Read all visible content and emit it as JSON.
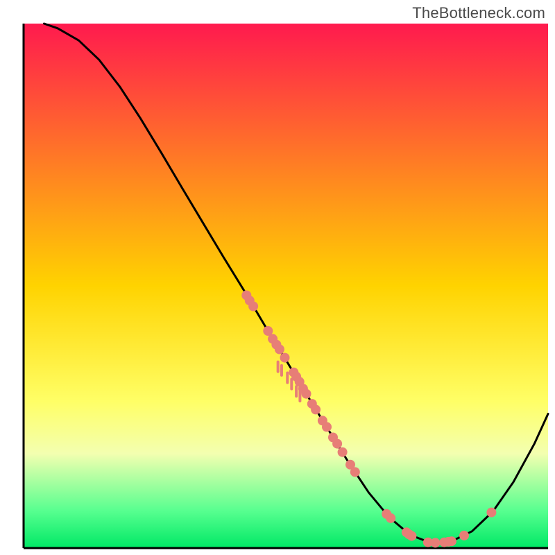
{
  "watermark": "TheBottleneck.com",
  "chart_data": {
    "type": "line",
    "title": "",
    "xlabel": "",
    "ylabel": "",
    "xlim": [
      0,
      100
    ],
    "ylim": [
      0,
      100
    ],
    "background_gradient": {
      "stops": [
        {
          "offset": 0.0,
          "color": "#ff1a4e"
        },
        {
          "offset": 0.5,
          "color": "#ffd300"
        },
        {
          "offset": 0.72,
          "color": "#ffff66"
        },
        {
          "offset": 0.82,
          "color": "#f3ffb0"
        },
        {
          "offset": 0.93,
          "color": "#56ff8f"
        },
        {
          "offset": 1.0,
          "color": "#00e865"
        }
      ]
    },
    "series": [
      {
        "name": "curve",
        "type": "line",
        "color": "#000000",
        "points": [
          {
            "x": 3.9,
            "y": 100.0
          },
          {
            "x": 6.5,
            "y": 99.1
          },
          {
            "x": 10.5,
            "y": 96.8
          },
          {
            "x": 14.4,
            "y": 93.1
          },
          {
            "x": 18.4,
            "y": 87.9
          },
          {
            "x": 22.3,
            "y": 81.9
          },
          {
            "x": 26.3,
            "y": 75.3
          },
          {
            "x": 30.2,
            "y": 68.7
          },
          {
            "x": 34.2,
            "y": 62.0
          },
          {
            "x": 38.1,
            "y": 55.5
          },
          {
            "x": 42.1,
            "y": 49.0
          },
          {
            "x": 46.0,
            "y": 42.4
          },
          {
            "x": 50.0,
            "y": 35.9
          },
          {
            "x": 53.9,
            "y": 29.4
          },
          {
            "x": 57.9,
            "y": 22.9
          },
          {
            "x": 61.8,
            "y": 16.6
          },
          {
            "x": 65.8,
            "y": 10.6
          },
          {
            "x": 69.7,
            "y": 5.9
          },
          {
            "x": 73.7,
            "y": 2.5
          },
          {
            "x": 77.6,
            "y": 1.0
          },
          {
            "x": 81.6,
            "y": 1.3
          },
          {
            "x": 85.5,
            "y": 3.2
          },
          {
            "x": 89.5,
            "y": 7.0
          },
          {
            "x": 93.4,
            "y": 12.6
          },
          {
            "x": 97.4,
            "y": 19.9
          },
          {
            "x": 100.0,
            "y": 25.6
          }
        ]
      },
      {
        "name": "data-points",
        "type": "scatter",
        "color": "#e77e77",
        "points": [
          {
            "x": 42.5,
            "y": 48.2
          },
          {
            "x": 43.1,
            "y": 47.2
          },
          {
            "x": 43.8,
            "y": 46.1
          },
          {
            "x": 46.6,
            "y": 41.4
          },
          {
            "x": 47.5,
            "y": 39.9
          },
          {
            "x": 48.2,
            "y": 38.8
          },
          {
            "x": 48.8,
            "y": 37.9
          },
          {
            "x": 49.8,
            "y": 36.3
          },
          {
            "x": 51.5,
            "y": 33.5
          },
          {
            "x": 52.0,
            "y": 32.7
          },
          {
            "x": 52.6,
            "y": 31.7
          },
          {
            "x": 53.3,
            "y": 30.4
          },
          {
            "x": 53.9,
            "y": 29.4
          },
          {
            "x": 55.0,
            "y": 27.5
          },
          {
            "x": 55.7,
            "y": 26.4
          },
          {
            "x": 57.0,
            "y": 24.3
          },
          {
            "x": 57.8,
            "y": 23.1
          },
          {
            "x": 59.0,
            "y": 21.1
          },
          {
            "x": 59.8,
            "y": 19.9
          },
          {
            "x": 60.8,
            "y": 18.3
          },
          {
            "x": 62.3,
            "y": 15.9
          },
          {
            "x": 63.2,
            "y": 14.5
          },
          {
            "x": 69.2,
            "y": 6.5
          },
          {
            "x": 70.0,
            "y": 5.7
          },
          {
            "x": 73.0,
            "y": 3.0
          },
          {
            "x": 73.5,
            "y": 2.6
          },
          {
            "x": 74.0,
            "y": 2.3
          },
          {
            "x": 77.1,
            "y": 1.1
          },
          {
            "x": 78.5,
            "y": 1.0
          },
          {
            "x": 80.2,
            "y": 1.1
          },
          {
            "x": 81.0,
            "y": 1.2
          },
          {
            "x": 81.6,
            "y": 1.3
          },
          {
            "x": 84.0,
            "y": 2.4
          },
          {
            "x": 89.2,
            "y": 6.8
          }
        ]
      },
      {
        "name": "tick-marks",
        "type": "scatter",
        "color": "#e77e77",
        "shape": "tick",
        "points": [
          {
            "x": 48.5,
            "y": 35.5
          },
          {
            "x": 49.2,
            "y": 34.8
          },
          {
            "x": 50.3,
            "y": 33.4
          },
          {
            "x": 51.1,
            "y": 32.2
          },
          {
            "x": 52.0,
            "y": 30.8
          },
          {
            "x": 52.7,
            "y": 29.9
          }
        ]
      }
    ]
  }
}
